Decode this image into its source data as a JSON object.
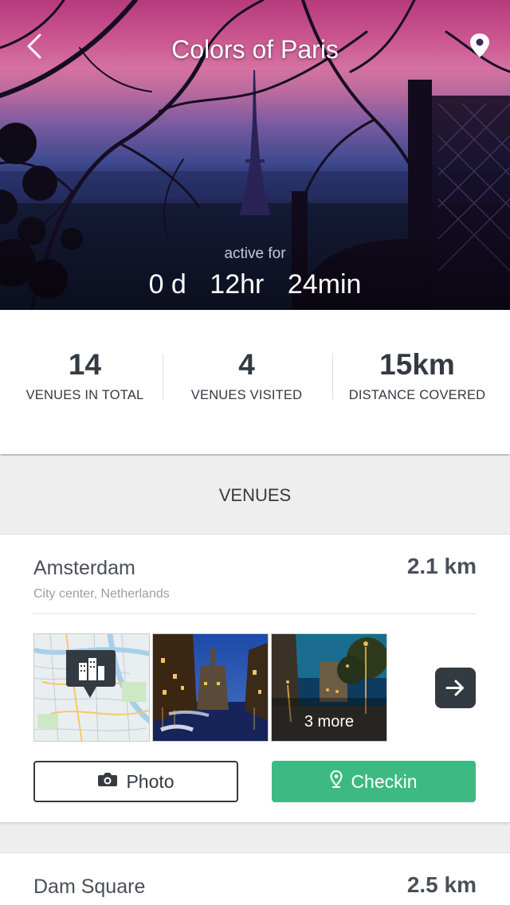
{
  "header": {
    "title": "Colors of Paris",
    "active_label": "active for",
    "timer": {
      "days": "0 d",
      "hours": "12hr",
      "minutes": "24min"
    }
  },
  "stats": [
    {
      "value": "14",
      "label": "VENUES IN TOTAL"
    },
    {
      "value": "4",
      "label": "VENUES VISITED"
    },
    {
      "value": "15km",
      "label": "DISTANCE COVERED"
    }
  ],
  "venues_heading": "VENUES",
  "venues": [
    {
      "name": "Amsterdam",
      "distance": "2.1 km",
      "subtitle": "City center, Netherlands",
      "more_label": "3 more",
      "photo_label": "Photo",
      "checkin_label": "Checkin"
    },
    {
      "name": "Dam Square",
      "distance": "2.5 km"
    }
  ],
  "icons": {
    "back": "chevron-left-icon",
    "location": "map-pin-icon",
    "next": "arrow-right-icon",
    "camera": "camera-icon",
    "checkin": "location-pin-icon",
    "building": "building-icon"
  },
  "colors": {
    "accent_green": "#3dba84",
    "dark": "#333a42",
    "muted": "#9a9ea4"
  }
}
